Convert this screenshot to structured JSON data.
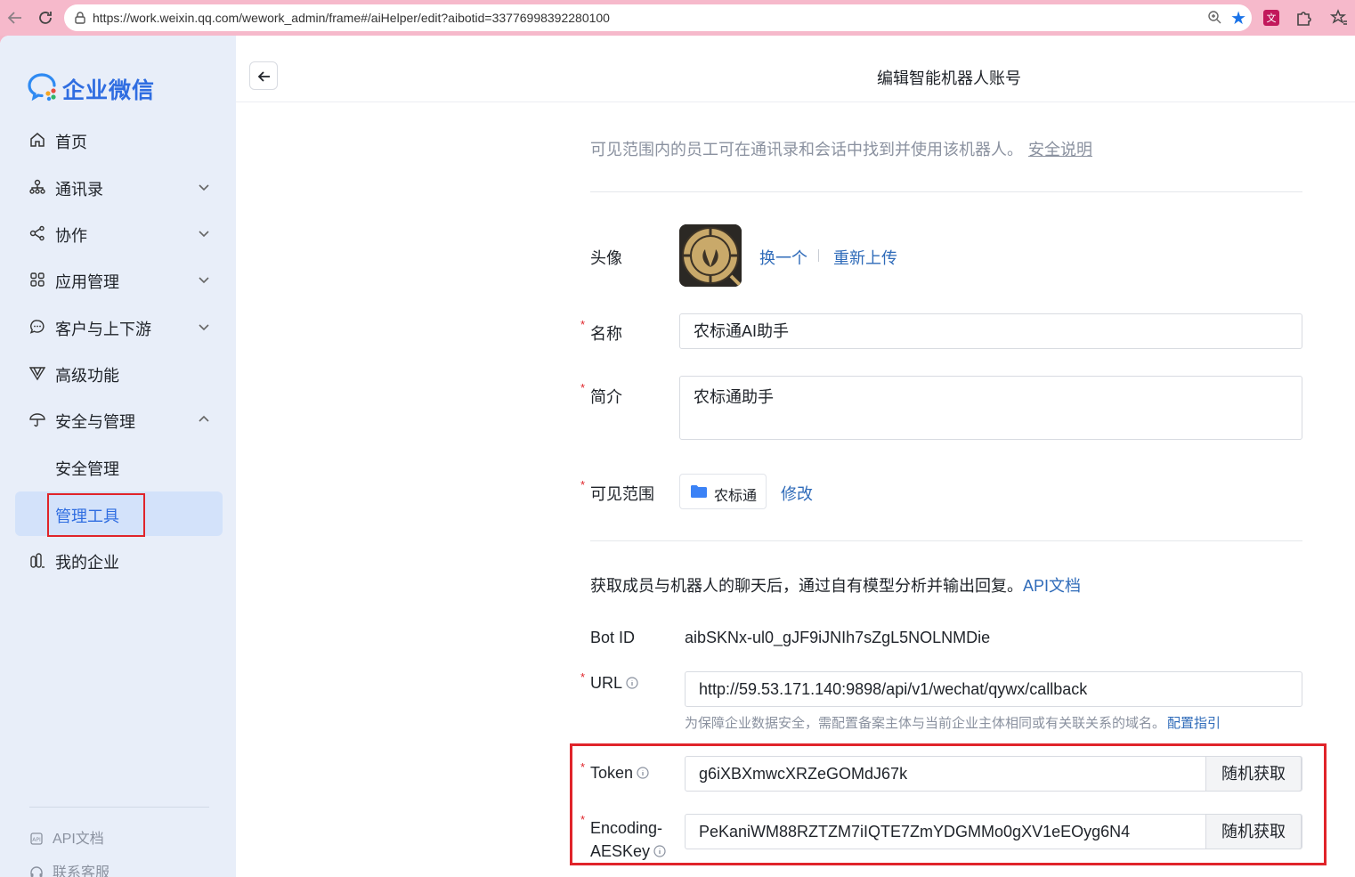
{
  "browser": {
    "url": "https://work.weixin.qq.com/wework_admin/frame#/aiHelper/edit?aibotid=33776998392280100"
  },
  "sidebar": {
    "logo": "企业微信",
    "items": [
      {
        "label": "首页",
        "icon": "home-icon"
      },
      {
        "label": "通讯录",
        "icon": "org-icon"
      },
      {
        "label": "协作",
        "icon": "collab-icon"
      },
      {
        "label": "应用管理",
        "icon": "apps-icon"
      },
      {
        "label": "客户与上下游",
        "icon": "chat-icon"
      },
      {
        "label": "高级功能",
        "icon": "advanced-icon"
      },
      {
        "label": "安全与管理",
        "icon": "umbrella-icon"
      },
      {
        "label": "安全管理"
      },
      {
        "label": "管理工具"
      },
      {
        "label": "我的企业",
        "icon": "building-icon"
      }
    ],
    "footer": {
      "api_docs": "API文档",
      "support": "联系客服"
    }
  },
  "header": {
    "title": "编辑智能机器人账号"
  },
  "form": {
    "visibility_note": "可见范围内的员工可在通讯录和会话中找到并使用该机器人。",
    "security_link": "安全说明",
    "avatar_label": "头像",
    "avatar_change": "换一个",
    "avatar_upload": "重新上传",
    "name_label": "名称",
    "name_value": "农标通AI助手",
    "intro_label": "简介",
    "intro_value": "农标通助手",
    "scope_label": "可见范围",
    "scope_value": "农标通",
    "scope_edit": "修改",
    "api_note": "获取成员与机器人的聊天后，通过自有模型分析并输出回复。",
    "api_link": "API文档",
    "botid_label": "Bot ID",
    "botid_value": "aibSKNx-ul0_gJF9iJNIh7sZgL5NOLNMDie",
    "url_label": "URL",
    "url_value": "http://59.53.171.140:9898/api/v1/wechat/qywx/callback",
    "url_hint": "为保障企业数据安全，需配置备案主体与当前企业主体相同或有关联关系的域名。",
    "url_hint_link": "配置指引",
    "token_label": "Token",
    "token_value": "g6iXBXmwcXRZeGOMdJ67k",
    "aeskey_label_1": "Encoding-",
    "aeskey_label_2": "AESKey",
    "aeskey_value": "PeKaniWM88RZTZM7iIQTE7ZmYDGMMo0gXV1eEOyg6N4",
    "random_btn": "随机获取",
    "required_mark": "*"
  },
  "colors": {
    "brand": "#2f6de1",
    "highlight": "#e0242a",
    "link": "#2f6bb9"
  }
}
